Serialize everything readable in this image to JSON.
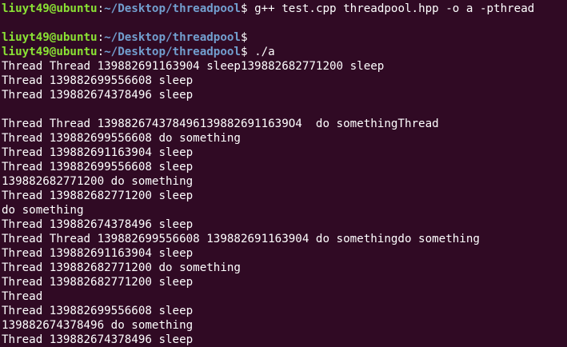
{
  "prompts": [
    {
      "user_host": "liuyt49@ubuntu",
      "colon": ":",
      "path": "~/Desktop/threadpool",
      "dollar": "$ ",
      "command": "g++ test.cpp threadpool.hpp -o a -pthread"
    },
    {
      "user_host": "liuyt49@ubuntu",
      "colon": ":",
      "path": "~/Desktop/threadpool",
      "dollar": "$",
      "command": ""
    },
    {
      "user_host": "liuyt49@ubuntu",
      "colon": ":",
      "path": "~/Desktop/threadpool",
      "dollar": "$ ",
      "command": "./a"
    }
  ],
  "output": [
    "Thread Thread 139882691163904 sleep139882682771200 sleep",
    "Thread 139882699556608 sleep",
    "Thread 139882674378496 sleep",
    "",
    "Thread Thread 1398826743784961398826911639O4  do somethingThread",
    "Thread 139882699556608 do something",
    "Thread 139882691163904 sleep",
    "Thread 139882699556608 sleep",
    "139882682771200 do something",
    "Thread 139882682771200 sleep",
    "do something",
    "Thread 139882674378496 sleep",
    "Thread Thread 139882699556608 139882691163904 do somethingdo something",
    "Thread 139882691163904 sleep",
    "Thread 139882682771200 do something",
    "Thread 139882682771200 sleep",
    "Thread",
    "Thread 139882699556608 sleep",
    "139882674378496 do something",
    "Thread 139882674378496 sleep"
  ],
  "colors": {
    "background": "#300a24",
    "prompt_user": "#8ae234",
    "prompt_path": "#729fcf",
    "text": "#ffffff"
  }
}
